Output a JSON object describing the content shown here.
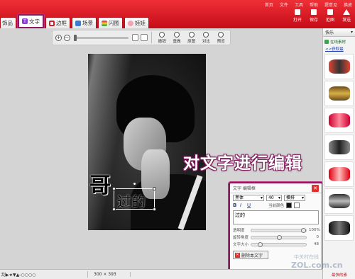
{
  "top_links": [
    "首页",
    "文件",
    "工具",
    "帮助",
    "提意见",
    "换皮"
  ],
  "tabs": [
    {
      "label": "饰品",
      "icon": "accessory-icon"
    },
    {
      "label": "文字",
      "icon": "text-icon",
      "active": true
    },
    {
      "label": "边框",
      "icon": "frame-icon"
    },
    {
      "label": "场景",
      "icon": "scene-icon"
    },
    {
      "label": "闪图",
      "icon": "flash-icon"
    },
    {
      "label": "娃娃",
      "icon": "doll-icon"
    }
  ],
  "top_tools": [
    "打开",
    "保存",
    "拒图",
    "发送"
  ],
  "toolbar": {
    "buttons": [
      "撤销",
      "重做",
      "原图",
      "对比",
      "预览"
    ]
  },
  "canvas": {
    "big_char": "哥",
    "text_box_value": "过的",
    "caption": "对文字进行编辑"
  },
  "edit_panel": {
    "title": "文字 编辑框",
    "font": "黑体",
    "size": "40",
    "style": "横排",
    "bold": "B",
    "italic": "I",
    "underline": "U",
    "current_color_label": "当前颜色",
    "text_value": "过的",
    "transparency_label": "透明度",
    "transparency_value": "100%",
    "transparency_fraction": 1.0,
    "rotation_label": "旋转角度",
    "rotation_value": "0",
    "rotation_fraction": 0.5,
    "size_label": "文字大小",
    "size_value": "48",
    "size_fraction": 0.12,
    "delete_label": "删除本文字"
  },
  "sidebar": {
    "category": "快乐",
    "online": "在线素材",
    "more_link": "<<获取最",
    "bottom": "最快的素"
  },
  "status": {
    "filename": "刮▶★▼▲-○○○○",
    "dims": "300 × 393"
  },
  "watermark": {
    "text": "ZOL.com.cn",
    "cn": "中关村在线"
  },
  "colors": {
    "brand_red": "#d31a24",
    "highlight": "#8b1a63",
    "close_red": "#e03030"
  }
}
